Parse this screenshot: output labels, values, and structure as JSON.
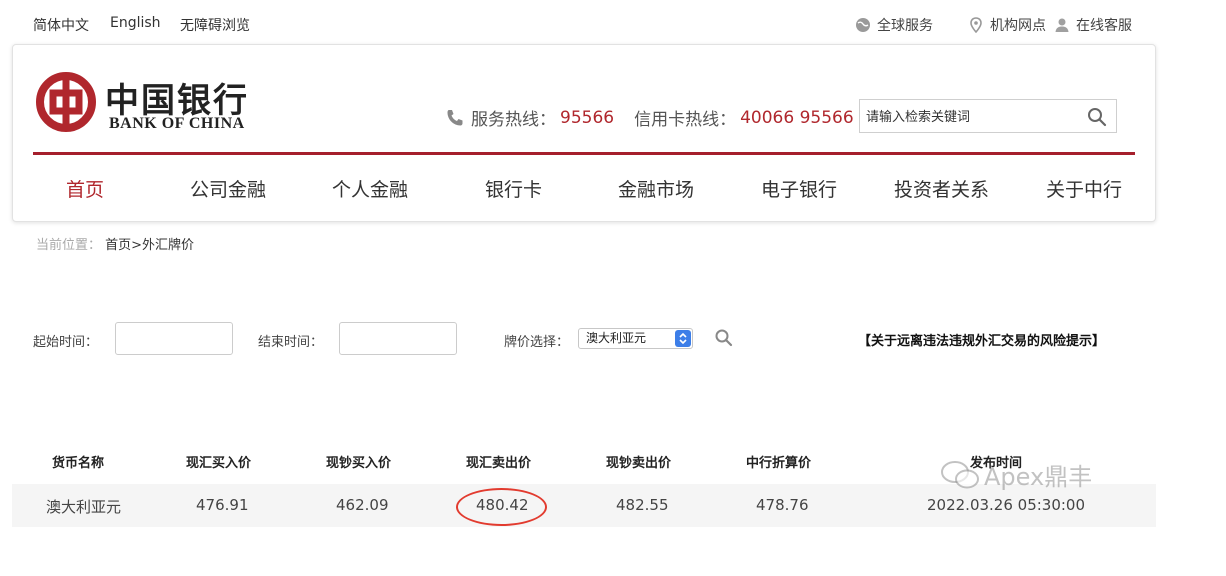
{
  "topbar": {
    "lang_simplified": "简体中文",
    "lang_english": "English",
    "accessibility": "无障碍浏览",
    "global_service": "全球服务",
    "branches": "机构网点",
    "online_service": "在线客服"
  },
  "header": {
    "logo_cn": "中国银行",
    "logo_en": "BANK OF CHINA",
    "hotline_label": "服务热线：",
    "hotline_number": "95566",
    "card_hotline_label": "信用卡热线：",
    "card_hotline_number": "40066 95566",
    "search_placeholder": "请输入检索关键词"
  },
  "nav": {
    "items": [
      {
        "label": "首页"
      },
      {
        "label": "公司金融"
      },
      {
        "label": "个人金融"
      },
      {
        "label": "银行卡"
      },
      {
        "label": "金融市场"
      },
      {
        "label": "电子银行"
      },
      {
        "label": "投资者关系"
      },
      {
        "label": "关于中行"
      }
    ]
  },
  "breadcrumb": {
    "label": "当前位置：",
    "path": "首页>外汇牌价"
  },
  "filters": {
    "start_label": "起始时间：",
    "start_value": "",
    "end_label": "结束时间：",
    "end_value": "",
    "currency_label": "牌价选择：",
    "currency_selected": "澳大利亚元",
    "risk_notice": "【关于远离违法违规外汇交易的风险提示】"
  },
  "table": {
    "headers": [
      "货币名称",
      "现汇买入价",
      "现钞买入价",
      "现汇卖出价",
      "现钞卖出价",
      "中行折算价",
      "发布时间"
    ],
    "rows": [
      [
        "澳大利亚元",
        "476.91",
        "462.09",
        "480.42",
        "482.55",
        "478.76",
        "2022.03.26 05:30:00"
      ]
    ]
  },
  "watermark": {
    "text": "Apex鼎丰"
  },
  "colors": {
    "brand_red": "#b0272d",
    "nav_line": "#a51f2c",
    "highlight": "#e23b2f",
    "select_blue": "#3c7ee8"
  }
}
